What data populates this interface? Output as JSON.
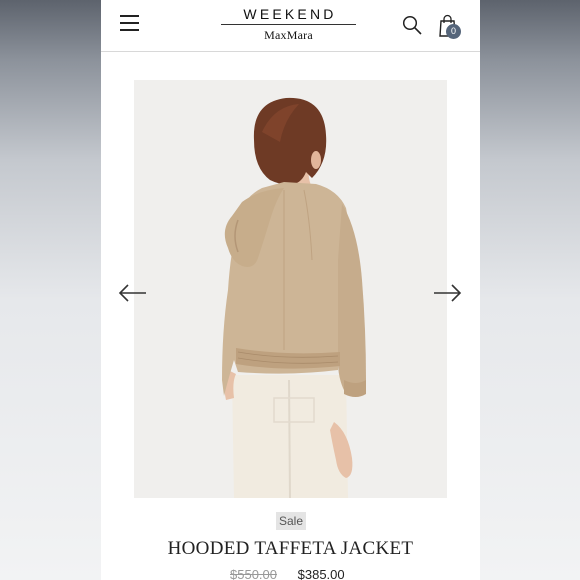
{
  "header": {
    "brand_top": "WEEKEND",
    "brand_bottom": "MaxMara",
    "cart_count": "0",
    "icons": [
      "hamburger-menu-icon",
      "search-icon",
      "shopping-bag-icon"
    ]
  },
  "product": {
    "badge": "Sale",
    "name": "HOODED TAFFETA JACKET",
    "price_original": "$550.00",
    "price_sale": "$385.00",
    "image_alt": "Woman wearing a beige hooded taffeta jacket, back view"
  },
  "carousel": {
    "prev_icon": "arrow-left-icon",
    "next_icon": "arrow-right-icon"
  },
  "colors": {
    "jacket": "#cdb596",
    "hair": "#6e3a25",
    "badge_bg": "#e4e4e4",
    "cart_badge": "#55657a"
  }
}
